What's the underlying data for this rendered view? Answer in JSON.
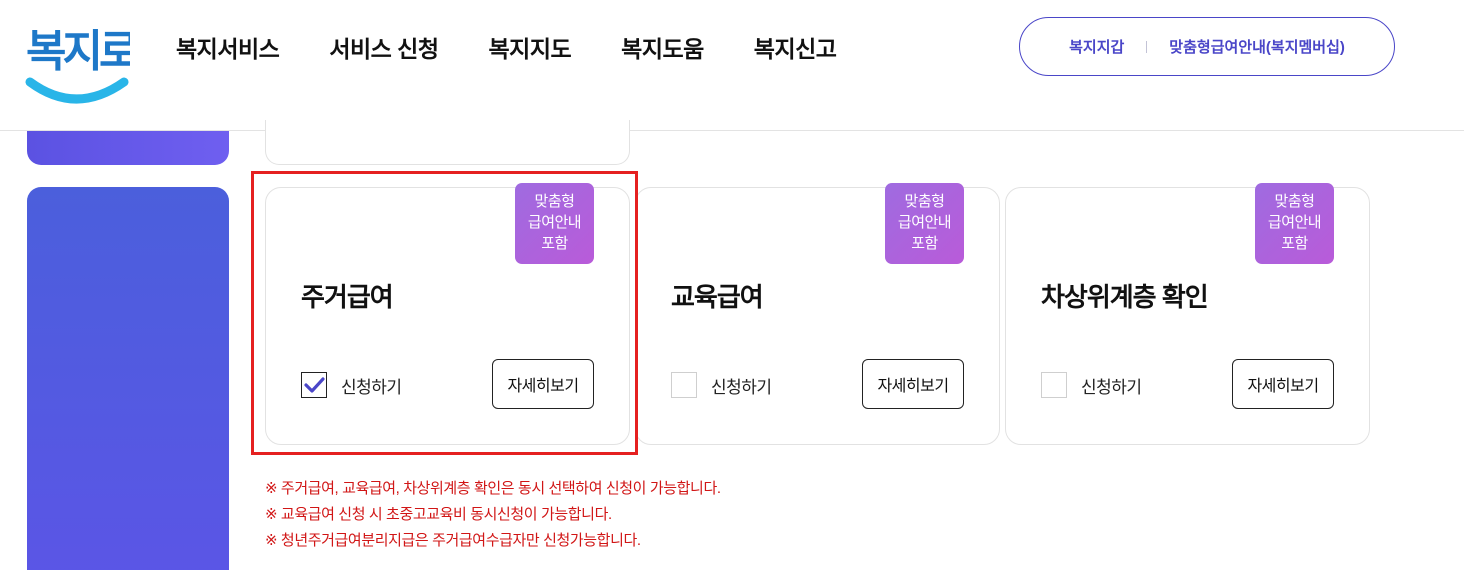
{
  "header": {
    "logo_text": "복지로",
    "nav": [
      "복지서비스",
      "서비스 신청",
      "복지지도",
      "복지도움",
      "복지신고"
    ],
    "pill_links": [
      "복지지갑",
      "맞춤형급여안내(복지멤버십)"
    ]
  },
  "colors": {
    "accent": "#4a46c8",
    "sidebar": "#5b55e6",
    "badge": "#b95bd9",
    "warning": "#d11616",
    "highlight": "#e52020"
  },
  "cards": [
    {
      "title": "주거급여",
      "badge": [
        "맞춤형",
        "급여안내",
        "포함"
      ],
      "checkbox_label": "신청하기",
      "checked": true,
      "detail_button": "자세히보기"
    },
    {
      "title": "교육급여",
      "badge": [
        "맞춤형",
        "급여안내",
        "포함"
      ],
      "checkbox_label": "신청하기",
      "checked": false,
      "detail_button": "자세히보기"
    },
    {
      "title": "차상위계층 확인",
      "badge": [
        "맞춤형",
        "급여안내",
        "포함"
      ],
      "checkbox_label": "신청하기",
      "checked": false,
      "detail_button": "자세히보기"
    }
  ],
  "notes": [
    "※ 주거급여, 교육급여, 차상위계층 확인은 동시 선택하여 신청이 가능합니다.",
    "※ 교육급여 신청 시 초중고교육비 동시신청이 가능합니다.",
    "※ 청년주거급여분리지급은 주거급여수급자만 신청가능합니다."
  ]
}
